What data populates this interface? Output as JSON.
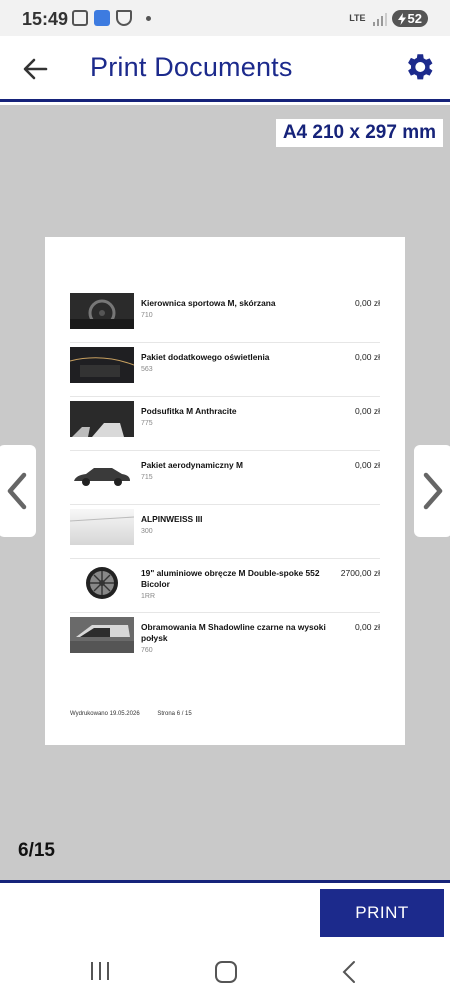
{
  "status": {
    "time": "15:49",
    "network": "LTE",
    "battery": "52"
  },
  "header": {
    "title": "Print Documents"
  },
  "paper_size": "A4 210 x 297 mm",
  "document": {
    "items": [
      {
        "name": "Kierownica sportowa M, skórzana",
        "code": "710",
        "price": "0,00 zł",
        "thumb": "steering-wheel"
      },
      {
        "name": "Pakiet dodatkowego oświetlenia",
        "code": "563",
        "price": "0,00 zł",
        "thumb": "interior-lighting"
      },
      {
        "name": "Podsufitka M Anthracite",
        "code": "775",
        "price": "0,00 zł",
        "thumb": "headliner"
      },
      {
        "name": "Pakiet aerodynamiczny M",
        "code": "715",
        "price": "0,00 zł",
        "thumb": "car-side"
      },
      {
        "name": "ALPINWEISS  III",
        "code": "300",
        "price": "",
        "thumb": "white-paint"
      },
      {
        "name": "19\" aluminiowe obręcze M Double-spoke 552 Bicolor",
        "code": "1RR",
        "price": "2700,00 zł",
        "thumb": "wheel-rim"
      },
      {
        "name": "Obramowania M Shadowline czarne na wysoki połysk",
        "code": "760",
        "price": "0,00 zł",
        "thumb": "window-trim"
      }
    ],
    "printed": "Wydrukowano 19.05.2026",
    "page_label": "Strona 6 / 15"
  },
  "page_counter": "6/15",
  "actions": {
    "print_label": "PRINT"
  },
  "colors": {
    "brand_blue": "#1c2a8c",
    "viewer_grey": "#c9c9c9"
  }
}
